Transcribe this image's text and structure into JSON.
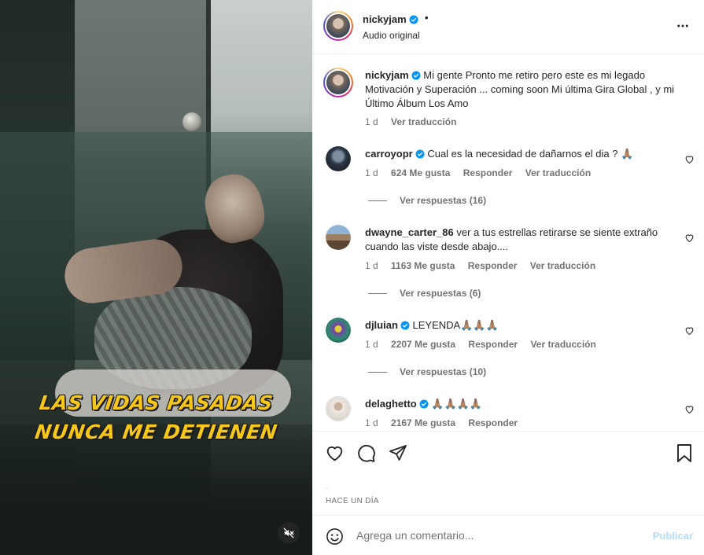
{
  "post": {
    "username": "nickyjam",
    "subtitle": "Audio original",
    "dot": "•"
  },
  "video": {
    "caption_line1": "LAS VIDAS PASADAS",
    "caption_line2": "NUNCA ME DETIENEN",
    "mute_icon": "speaker-muted-icon"
  },
  "caption_comment": {
    "username": "nickyjam",
    "text": "Mi gente Pronto me retiro pero este es mi legado Motivación y Superación ... coming soon Mi última Gira Global , y mi Último Álbum Los Amo",
    "age": "1 d",
    "translate": "Ver traducción"
  },
  "comments": [
    {
      "username": "carroyopr",
      "verified": true,
      "text": "Cual es la necesidad de dañarnos el dia ? 🙏🏽",
      "age": "1 d",
      "likes": "624 Me gusta",
      "reply": "Responder",
      "translate": "Ver traducción",
      "replies": "Ver respuestas (16)"
    },
    {
      "username": "dwayne_carter_86",
      "verified": false,
      "text": "ver a tus estrellas retirarse se siente extraño cuando las viste desde abajo....",
      "age": "1 d",
      "likes": "1163 Me gusta",
      "reply": "Responder",
      "translate": "Ver traducción",
      "replies": "Ver respuestas (6)"
    },
    {
      "username": "djluian",
      "verified": true,
      "text": "LEYENDA🙏🏽🙏🏽🙏🏽",
      "age": "1 d",
      "likes": "2207 Me gusta",
      "reply": "Responder",
      "translate": "Ver traducción",
      "replies": "Ver respuestas (10)"
    },
    {
      "username": "delaghetto",
      "verified": true,
      "text": "🙏🏽🙏🏽🙏🏽🙏🏽",
      "age": "1 d",
      "likes": "2167 Me gusta",
      "reply": "Responder"
    }
  ],
  "actions": {
    "likes_hidden": ".",
    "timestamp": "HACE UN DÍA"
  },
  "composer": {
    "placeholder": "Agrega un comentario...",
    "publish": "Publicar"
  },
  "colors": {
    "verified": "#0095f6",
    "caption_yellow": "#f6c618",
    "publish_disabled": "#b3dbff"
  }
}
